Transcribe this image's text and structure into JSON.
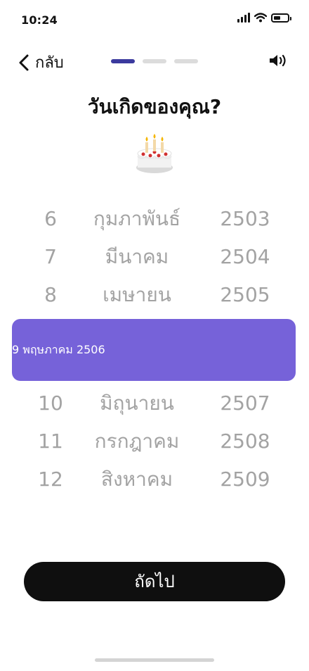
{
  "status_bar": {
    "time": "10:24",
    "battery_level": 0.5
  },
  "nav": {
    "back_label": "กลับ",
    "progress": {
      "total_steps": 3,
      "current_step": 1
    }
  },
  "page": {
    "title": "วันเกิดของคุณ?"
  },
  "picker": {
    "rows_above": [
      {
        "day": "6",
        "month": "กุมภาพันธ์",
        "year": "2503"
      },
      {
        "day": "7",
        "month": "มีนาคม",
        "year": "2504"
      },
      {
        "day": "8",
        "month": "เมษายน",
        "year": "2505"
      }
    ],
    "selected": {
      "day": "9",
      "month": "พฤษภาคม",
      "year": "2506"
    },
    "rows_below": [
      {
        "day": "10",
        "month": "มิถุนายน",
        "year": "2507"
      },
      {
        "day": "11",
        "month": "กรกฎาคม",
        "year": "2508"
      },
      {
        "day": "12",
        "month": "สิงหาคม",
        "year": "2509"
      }
    ]
  },
  "footer": {
    "next_label": "ถัดไป"
  },
  "colors": {
    "accent": "#7662D9",
    "progress_active": "#3B3A9E",
    "progress_inactive": "#DCDCDC",
    "dimmed_text": "#A3A3A3",
    "button_bg": "#0F0F0F"
  },
  "icons": [
    "signal-icon",
    "wifi-icon",
    "battery-icon",
    "chevron-left-icon",
    "speaker-icon",
    "birthday-cake-icon"
  ]
}
